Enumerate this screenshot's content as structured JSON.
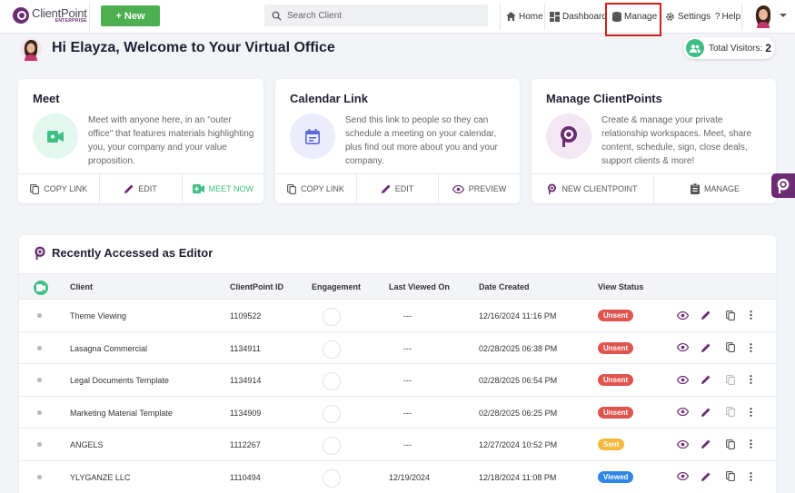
{
  "brand": {
    "name": "ClientPoint",
    "edition": "ENTERPRISE",
    "accent": "#6b2c73",
    "green": "#4caf50",
    "teal": "#3fbf86"
  },
  "topbar": {
    "new_label": "+ New",
    "search_placeholder": "Search Client",
    "nav": {
      "home": "Home",
      "dashboard": "Dashboard",
      "manage": "Manage",
      "settings": "Settings",
      "help": "Help"
    }
  },
  "welcome": {
    "greeting": "Hi Elayza, Welcome to Your Virtual Office",
    "visitors_label": "Total Visitors:",
    "visitors_count": "2"
  },
  "cards": {
    "meet": {
      "title": "Meet",
      "description": "Meet with anyone here, in an \"outer office\" that features materials highlighting you, your company and your value proposition.",
      "actions": [
        "COPY LINK",
        "EDIT",
        "MEET NOW"
      ]
    },
    "calendar": {
      "title": "Calendar Link",
      "description": "Send this link to people so they can schedule a meeting on your calendar, plus find out more about you and your company.",
      "actions": [
        "COPY LINK",
        "EDIT",
        "PREVIEW"
      ]
    },
    "manage": {
      "title": "Manage ClientPoints",
      "description": "Create & manage your private relationship workspaces. Meet, share content, schedule, sign, close deals, support clients & more!",
      "actions": [
        "NEW CLIENTPOINT",
        "MANAGE"
      ]
    }
  },
  "recent": {
    "title": "Recently Accessed as Editor",
    "columns": [
      "Client",
      "ClientPoint ID",
      "Engagement",
      "Last Viewed On",
      "Date Created",
      "View Status"
    ],
    "rows": [
      {
        "client": "Theme Viewing",
        "id": "1109522",
        "last_viewed": "---",
        "created": "12/16/2024 11:16 PM",
        "status": "Unsent"
      },
      {
        "client": "Lasagna Commercial",
        "id": "1134911",
        "last_viewed": "---",
        "created": "02/28/2025 06:38 PM",
        "status": "Unsent"
      },
      {
        "client": "Legal Documents Template",
        "id": "1134914",
        "last_viewed": "---",
        "created": "02/28/2025 06:54 PM",
        "status": "Unsent"
      },
      {
        "client": "Marketing Material Template",
        "id": "1134909",
        "last_viewed": "---",
        "created": "02/28/2025 06:25 PM",
        "status": "Unsent"
      },
      {
        "client": "ANGELS",
        "id": "1112267",
        "last_viewed": "---",
        "created": "12/27/2024 10:52 PM",
        "status": "Sent"
      },
      {
        "client": "YLYGANZE LLC",
        "id": "1110494",
        "last_viewed": "12/19/2024",
        "created": "12/18/2024 11:08 PM",
        "status": "Viewed"
      }
    ],
    "status_colors": {
      "Unsent": "#e0544f",
      "Sent": "#f5b83d",
      "Viewed": "#2f86e8"
    }
  }
}
